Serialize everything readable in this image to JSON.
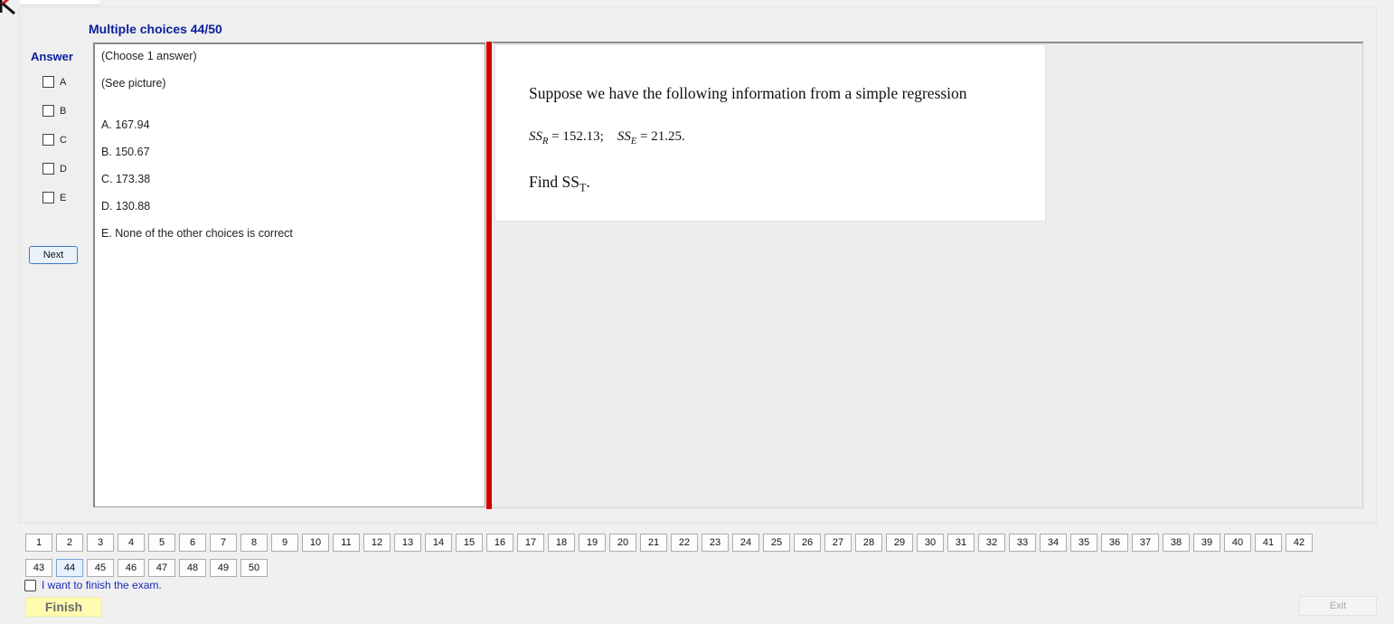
{
  "header": {
    "title": "Multiple choices 44/50"
  },
  "answer_panel": {
    "label": "Answer",
    "options": [
      "A",
      "B",
      "C",
      "D",
      "E"
    ],
    "next_label": "Next"
  },
  "choices_panel": {
    "instruction": "(Choose 1 answer)",
    "see_picture": "(See picture)",
    "choices": [
      "A.  167.94",
      "B.  150.67",
      "C.  173.38",
      "D.  130.88",
      "E.  None of the other choices is correct"
    ]
  },
  "question_image": {
    "line1": "Suppose we have the following information from a simple regression",
    "ssr_symbol": "SS",
    "ssr_sub": "R",
    "ssr_value": "= 152.13;",
    "sse_symbol": "SS",
    "sse_sub": "E",
    "sse_value": "= 21.25.",
    "find_prefix": "Find SS",
    "find_sub": "T",
    "find_suffix": "."
  },
  "navigation": {
    "current": "44",
    "row1": [
      "1",
      "2",
      "3",
      "4",
      "5",
      "6",
      "7",
      "8",
      "9",
      "10",
      "11",
      "12",
      "13",
      "14",
      "15",
      "16",
      "17",
      "18",
      "19",
      "20",
      "21",
      "22",
      "23",
      "24",
      "25",
      "26",
      "27",
      "28",
      "29",
      "30",
      "31",
      "32",
      "33",
      "34",
      "35",
      "36",
      "37",
      "38",
      "39",
      "40",
      "41",
      "42"
    ],
    "row2": [
      "43",
      "44",
      "45",
      "46",
      "47",
      "48",
      "49",
      "50"
    ]
  },
  "footer": {
    "finish_confirm_label": "I want to finish the exam.",
    "finish_label": "Finish",
    "exit_label": "Exit"
  },
  "colors": {
    "title_blue": "#0a1e9a",
    "divider_red": "#d40000",
    "finish_yellow": "#fffbb0"
  }
}
